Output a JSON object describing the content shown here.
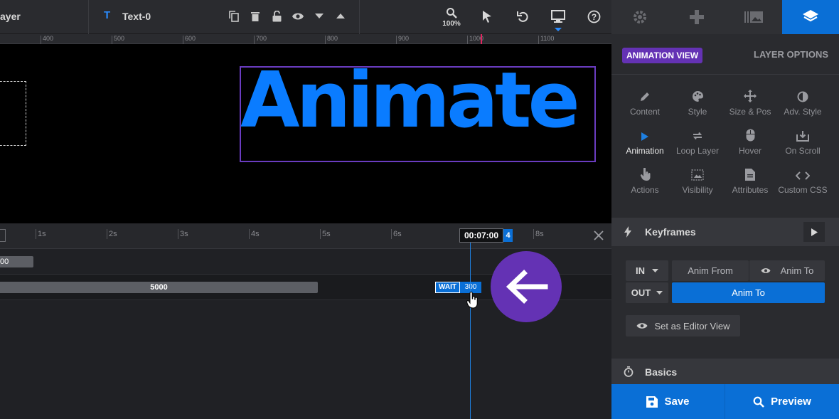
{
  "topbar": {
    "layer_label": "ayer",
    "layer_name": "Text-0",
    "zoom": "100%"
  },
  "ruler": {
    "ticks": [
      "400",
      "500",
      "600",
      "700",
      "800",
      "900",
      "1000",
      "1100"
    ]
  },
  "canvas": {
    "headline": "Animate"
  },
  "timeline": {
    "time_labels": [
      "1s",
      "2s",
      "3s",
      "4s",
      "5s",
      "6s",
      "8s"
    ],
    "current_time": "00:07:00",
    "cursor_badge": "4",
    "track1_value": "00",
    "track2_value": "5000",
    "wait_label": "WAIT",
    "wait_value": "300"
  },
  "panel": {
    "animation_view_label": "ANIMATION VIEW",
    "layer_options_label": "LAYER OPTIONS",
    "options": [
      {
        "label": "Content",
        "icon": "pencil-icon"
      },
      {
        "label": "Style",
        "icon": "palette-icon"
      },
      {
        "label": "Size & Pos",
        "icon": "move-icon"
      },
      {
        "label": "Adv. Style",
        "icon": "contrast-icon"
      },
      {
        "label": "Animation",
        "icon": "play-icon"
      },
      {
        "label": "Loop Layer",
        "icon": "loop-icon"
      },
      {
        "label": "Hover",
        "icon": "mouse-icon"
      },
      {
        "label": "On Scroll",
        "icon": "download-icon"
      },
      {
        "label": "Actions",
        "icon": "touch-icon"
      },
      {
        "label": "Visibility",
        "icon": "image-icon"
      },
      {
        "label": "Attributes",
        "icon": "document-icon"
      },
      {
        "label": "Custom CSS",
        "icon": "code-icon"
      }
    ],
    "keyframes_title": "Keyframes",
    "in_label": "IN",
    "out_label": "OUT",
    "anim_from_label": "Anim From",
    "anim_to_label": "Anim To",
    "anim_to_out_label": "Anim To",
    "editor_view_label": "Set as Editor View",
    "basics_title": "Basics",
    "save_label": "Save",
    "preview_label": "Preview"
  },
  "colors": {
    "accent_blue": "#0a6fd6",
    "purple": "#6432b4",
    "headline_blue": "#0a7cff"
  }
}
